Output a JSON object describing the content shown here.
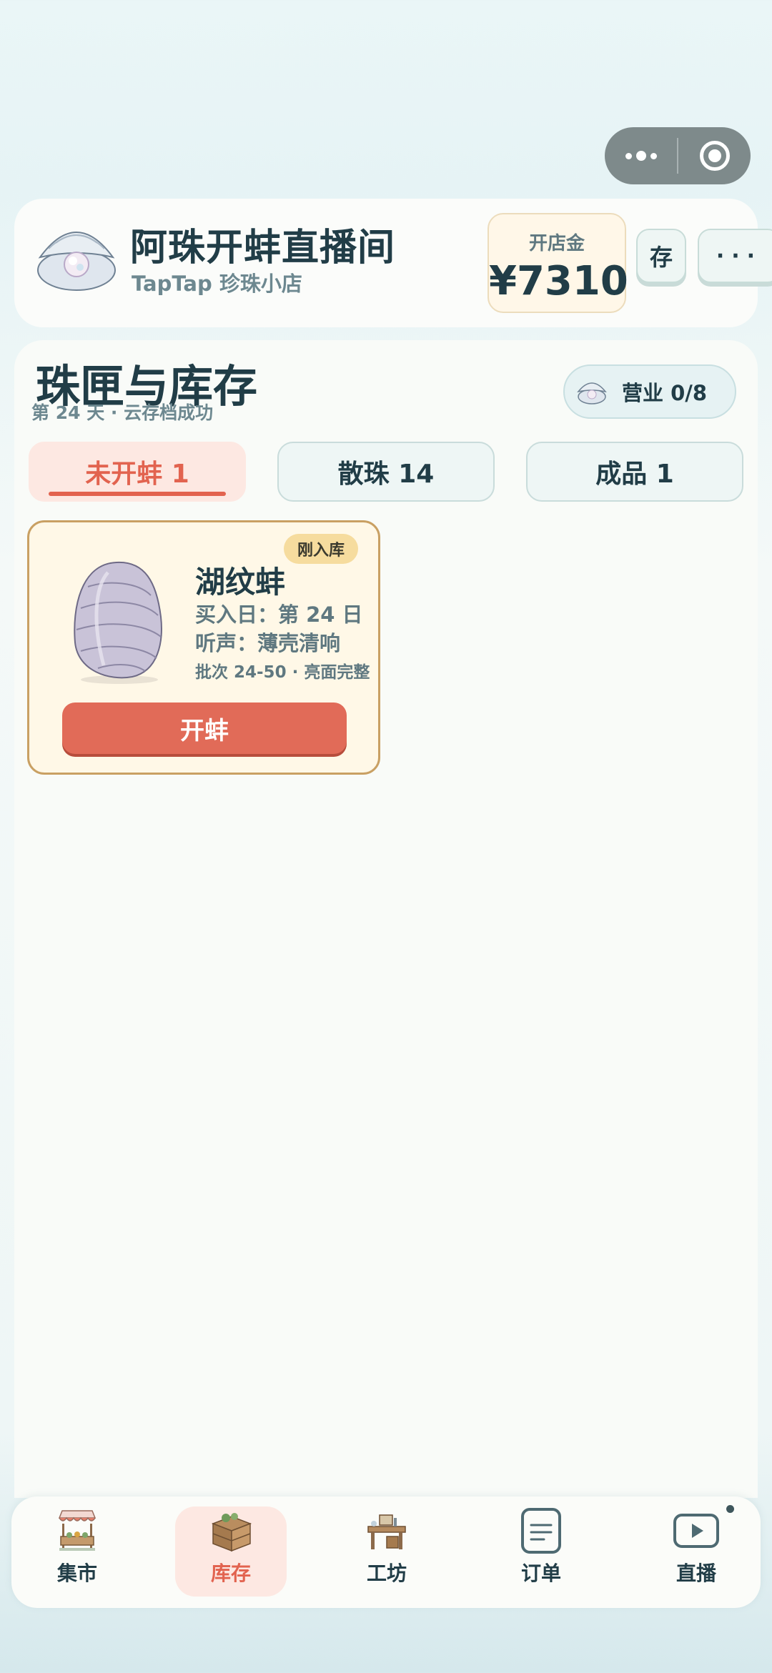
{
  "header": {
    "title": "阿珠开蚌直播间",
    "subtitle": "TapTap 珍珠小店",
    "fund_label": "开店金",
    "fund_value": "¥7310",
    "save_label": "存",
    "more_label": "···"
  },
  "main": {
    "title": "珠匣与库存",
    "subtitle": "第 24 天 · 云存档成功",
    "business_label": "营业 0/8",
    "tabs": [
      {
        "label": "未开蚌 1",
        "active": true
      },
      {
        "label": "散珠 14",
        "active": false
      },
      {
        "label": "成品 1",
        "active": false
      }
    ],
    "clam": {
      "badge": "刚入库",
      "name": "湖纹蚌",
      "buy_date": "买入日：第 24 日",
      "sound": "听声：薄壳清响",
      "batch": "批次 24-50 · 亮面完整",
      "action_label": "开蚌"
    }
  },
  "nav": {
    "items": [
      {
        "label": "集市",
        "icon": "market-stall-icon",
        "active": false
      },
      {
        "label": "库存",
        "icon": "crate-icon",
        "active": true
      },
      {
        "label": "工坊",
        "icon": "workbench-icon",
        "active": false
      },
      {
        "label": "订单",
        "icon": "document-icon",
        "active": false
      },
      {
        "label": "直播",
        "icon": "play-video-icon",
        "active": false,
        "has_notification": true
      }
    ]
  },
  "colors": {
    "accent": "#e2634f",
    "ink": "#213d47",
    "muted": "#6d8890",
    "card_border": "#c9a063"
  }
}
